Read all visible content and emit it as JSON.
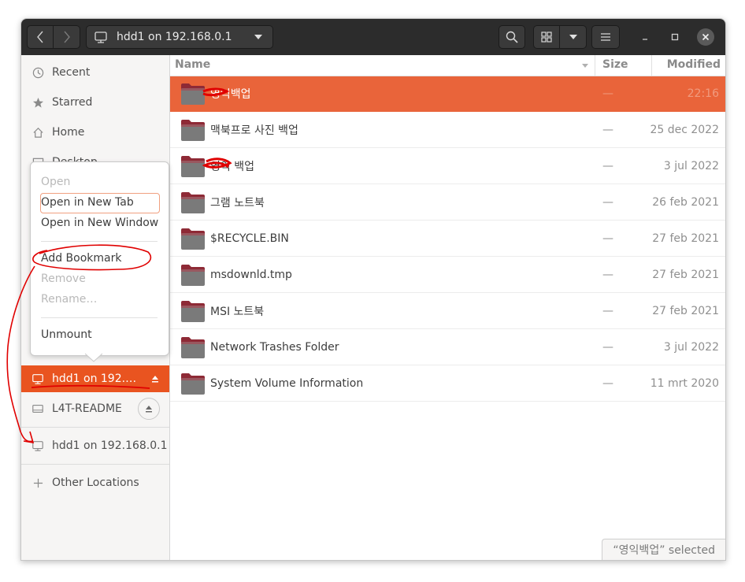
{
  "headerbar": {
    "path_label": "hdd1 on 192.168.0.1",
    "icons": {
      "back": "chevron-left-icon",
      "forward": "chevron-right-icon",
      "search": "search-icon",
      "view": "grid-view-icon",
      "menu": "hamburger-menu-icon"
    }
  },
  "sidebar": {
    "items": [
      {
        "label": "Recent",
        "icon": "clock-icon"
      },
      {
        "label": "Starred",
        "icon": "star-icon"
      },
      {
        "label": "Home",
        "icon": "home-icon"
      },
      {
        "label": "Desktop",
        "icon": "desktop-icon"
      }
    ],
    "mounts": [
      {
        "label": "hdd1 on 192.…",
        "icon": "network-drive-icon",
        "active": true
      },
      {
        "label": "L4T-README",
        "icon": "drive-icon"
      },
      {
        "label": "hdd1 on 192.168.0.1",
        "icon": "network-drive-icon"
      }
    ],
    "other_locations": "Other Locations"
  },
  "context_menu": {
    "items": [
      "Open",
      "Open in New Tab",
      "Open in New Window",
      "Add Bookmark",
      "Remove",
      "Rename…",
      "Unmount"
    ]
  },
  "columns": {
    "name": "Name",
    "size": "Size",
    "modified": "Modified"
  },
  "files": [
    {
      "name": "영익백업",
      "size": "—",
      "modified": "22:16"
    },
    {
      "name": "맥북프로 사진 백업",
      "size": "—",
      "modified": "25 dec 2022"
    },
    {
      "name": "영익 백업",
      "size": "—",
      "modified": "3 jul 2022"
    },
    {
      "name": "그램 노트북",
      "size": "—",
      "modified": "26 feb 2021"
    },
    {
      "name": "$RECYCLE.BIN",
      "size": "—",
      "modified": "27 feb 2021"
    },
    {
      "name": "msdownld.tmp",
      "size": "—",
      "modified": "27 feb 2021"
    },
    {
      "name": "MSI 노트북",
      "size": "—",
      "modified": "27 feb 2021"
    },
    {
      "name": "Network Trashes Folder",
      "size": "—",
      "modified": "3 jul 2022"
    },
    {
      "name": "System Volume Information",
      "size": "—",
      "modified": "11 mrt 2020"
    }
  ],
  "status": "“영익백업” selected",
  "colors": {
    "accent": "#e95420",
    "selection": "#e9643a",
    "headerbar": "#2c2c2c",
    "annotation": "#e00000"
  }
}
